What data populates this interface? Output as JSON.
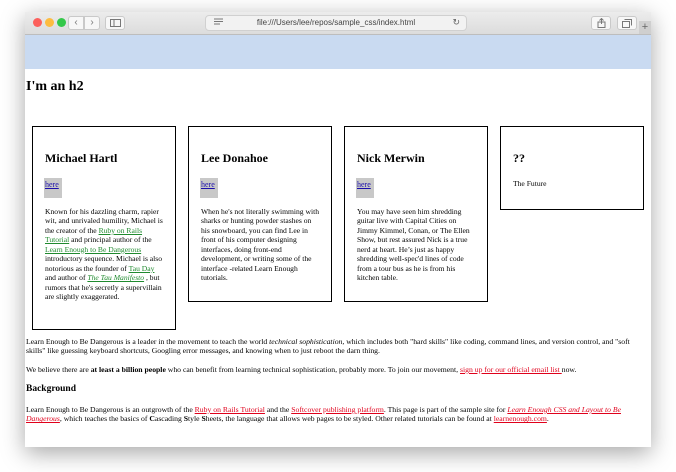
{
  "browser": {
    "url": "file:///Users/lee/repos/sample_css/index.html",
    "back_glyph": "‹",
    "forward_glyph": "›",
    "reload_glyph": "↻",
    "new_tab_glyph": "+",
    "icons": [
      "back-icon",
      "forward-icon",
      "sidebar-icon",
      "reader-icon",
      "reload-icon",
      "share-icon",
      "tabs-icon",
      "plus-icon"
    ]
  },
  "colors": {
    "banner": "#c9daf1",
    "card_link": "#1f8a2e",
    "body_link": "#e0001b",
    "here_link": "#1a0dab"
  },
  "page": {
    "heading": "I'm an h2",
    "cards": [
      {
        "name": "Michael Hartl",
        "link": "here",
        "bio": {
          "t1": "Known for his dazzling charm, rapier wit, and unrivaled humility, Michael is the creator of the ",
          "l1": "Ruby on Rails Tutorial",
          "t2": " and principal author of the ",
          "l2": "Learn Enough to Be Dangerous",
          "t3": " introductory sequence. Michael is also notorious as the founder of ",
          "l3": "Tau Day",
          "t4": " and author of ",
          "l4": "The Tau Manifesto",
          "t5": " , but rumors that he's secretly a supervillain are slightly exaggerated."
        }
      },
      {
        "name": "Lee Donahoe",
        "link": "here",
        "bio": "When he's not literally swimming with sharks or hunting powder stashes on his snowboard, you can find Lee in front of his computer designing interfaces, doing front-end development, or writing some of the interface -related Learn Enough tutorials."
      },
      {
        "name": "Nick Merwin",
        "link": "here",
        "bio": "You may have seen him shredding guitar live with Capital Cities on Jimmy Kimmel, Conan, or The Ellen Show, but rest assured Nick is a true nerd at heart. He’s just as happy shredding well-spec'd lines of code from a tour bus as he is from his kitchen table."
      },
      {
        "name": "??",
        "text": "The Future"
      }
    ],
    "intro": {
      "t1": "Learn Enough to Be Dangerous is a leader in the movement to teach the world ",
      "em": "technical sophistication",
      "t2": ", which includes both \"hard skills\" like coding, command lines, and version control, and \"soft skills\" like guessing keyboard shortcuts, Googling error messages, and knowing when to just reboot the darn thing."
    },
    "believe": {
      "t1": "We believe there are ",
      "strong": "at least a billion people",
      "t2": " who can benefit from learning technical sophistication, probably more. To join our movement, ",
      "link": "sign up for our official email list ",
      "t3": "now."
    },
    "background_heading": "Background",
    "background": {
      "t1": "Learn Enough to Be Dangerous is an outgrowth of the ",
      "l1": "Ruby on Rails Tutorial",
      "t2": " and the ",
      "l2": "Softcover publishing platform",
      "t3": ". This page is part of the sample site for ",
      "l3": "Learn Enough CSS and Layout to Be Dangerous",
      "t4": ", which teaches the basics of ",
      "b1": "C",
      "t5": "ascading ",
      "b2": "S",
      "t6": "tyle ",
      "b3": "S",
      "t7": "heets, the language that allows web pages to be styled. Other related tutorials can be found at ",
      "l4": "learnenough.com",
      "t8": "."
    }
  }
}
